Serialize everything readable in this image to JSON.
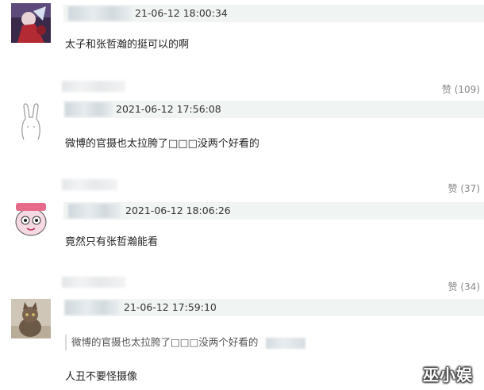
{
  "comments": [
    {
      "timestamp": "21-06-12 18:00:34",
      "text": "太子和张哲瀚的挺可以的啊",
      "avatar": "anime-character-avatar-icon"
    },
    {
      "likes": "赞 (109)",
      "timestamp": "2021-06-12 17:56:08",
      "text": "微博的官摄也太拉胯了□□□没两个好看的",
      "avatar": "rabbit-doodle-avatar-icon"
    },
    {
      "likes": "赞 (37)",
      "timestamp": "2021-06-12 18:06:26",
      "text": "竟然只有张哲瀚能看",
      "avatar": "cartoon-face-avatar-icon"
    },
    {
      "likes": "赞 (34)",
      "timestamp": "21-06-12 17:59:10",
      "quote": "微博的官摄也太拉胯了□□□没两个好看的",
      "text": "人丑不要怪摄像",
      "avatar": "cat-photo-avatar-icon"
    }
  ],
  "watermark": "巫小娱",
  "colors": {
    "meta_bar": "#f0f4f2",
    "like_text": "#888888"
  }
}
